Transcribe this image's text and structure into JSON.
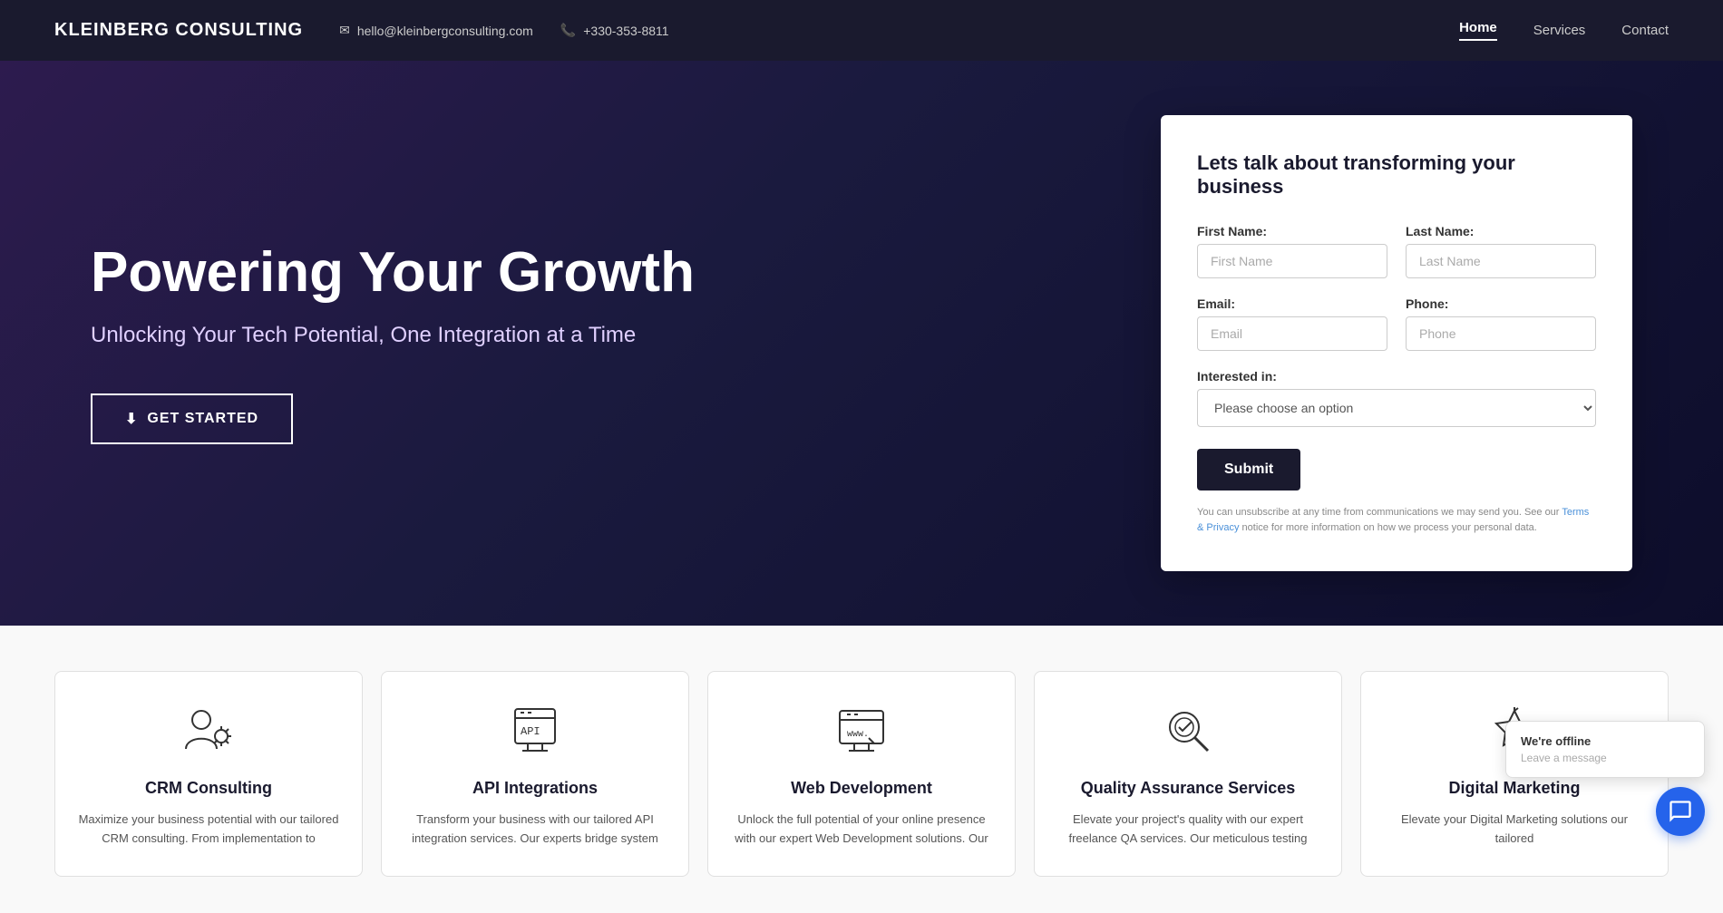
{
  "navbar": {
    "brand": "KLEINBERG CONSULTING",
    "email_icon": "✉",
    "email": "hello@kleinbergconsulting.com",
    "phone_icon": "📞",
    "phone": "+330-353-8811",
    "links": [
      {
        "label": "Home",
        "active": true
      },
      {
        "label": "Services",
        "active": false
      },
      {
        "label": "Contact",
        "active": false
      }
    ]
  },
  "hero": {
    "title": "Powering Your Growth",
    "subtitle": "Unlocking Your Tech Potential, One Integration at a Time",
    "cta_label": "GET STARTED",
    "cta_icon": "⬇"
  },
  "form": {
    "title": "Lets talk about transforming your business",
    "first_name_label": "First Name:",
    "first_name_placeholder": "First Name",
    "last_name_label": "Last Name:",
    "last_name_placeholder": "Last Name",
    "email_label": "Email:",
    "email_placeholder": "Email",
    "phone_label": "Phone:",
    "phone_placeholder": "Phone",
    "interested_label": "Interested in:",
    "interested_placeholder": "Please choose an option",
    "interested_options": [
      "Please choose an option",
      "CRM Consulting",
      "API Integrations",
      "Web Development",
      "Quality Assurance Services",
      "Digital Marketing"
    ],
    "submit_label": "Submit",
    "disclaimer": "You can unsubscribe at any time from communications we may send you. See our ",
    "disclaimer_link": "Terms & Privacy",
    "disclaimer_end": " notice for more information on how we process your personal data."
  },
  "services": [
    {
      "id": "crm",
      "title": "CRM Consulting",
      "description": "Maximize your business potential with our tailored CRM consulting. From implementation to"
    },
    {
      "id": "api",
      "title": "API Integrations",
      "description": "Transform your business with our tailored API integration services. Our experts bridge system"
    },
    {
      "id": "web",
      "title": "Web Development",
      "description": "Unlock the full potential of your online presence with our expert Web Development solutions. Our"
    },
    {
      "id": "qa",
      "title": "Quality Assurance Services",
      "description": "Elevate your project's quality with our expert freelance QA services. Our meticulous testing"
    },
    {
      "id": "digital",
      "title": "Digital Marketing",
      "description": "Elevate your Digital Marketing solutions our tailored"
    }
  ],
  "chat": {
    "status": "We're offline",
    "placeholder": "Leave a message"
  }
}
